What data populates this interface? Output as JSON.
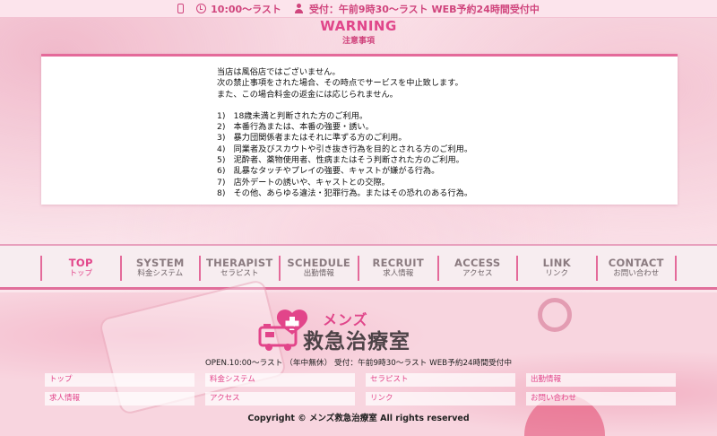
{
  "topbar": {
    "hours": "10:00〜ラスト",
    "reception": "受付：午前9時30〜ラスト WEB予約24時間受付中"
  },
  "warning": {
    "title": "WARNING",
    "subtitle": "注意事項",
    "intro": [
      "当店は風俗店ではございません。",
      "次の禁止事項をされた場合、その時点でサービスを中止致します。",
      "また、この場合料金の返金には応じられません。"
    ],
    "rules": [
      "1)　18歳未満と判断された方のご利用。",
      "2)　本番行為または、本番の強要・誘い。",
      "3)　暴力団関係者またはそれに準ずる方のご利用。",
      "4)　同業者及びスカウトや引き抜き行為を目的とされる方のご利用。",
      "5)　泥酔者、薬物使用者、性病またはそう判断された方のご利用。",
      "6)　乱暴なタッチやプレイの強要、キャストが嫌がる行為。",
      "7)　店外デートの誘いや、キャストとの交際。",
      "8)　その他、あらゆる違法・犯罪行為。またはその恐れのある行為。"
    ]
  },
  "nav": [
    {
      "en": "TOP",
      "jp": "トップ",
      "active": true
    },
    {
      "en": "SYSTEM",
      "jp": "料金システム"
    },
    {
      "en": "THERAPIST",
      "jp": "セラピスト"
    },
    {
      "en": "SCHEDULE",
      "jp": "出勤情報"
    },
    {
      "en": "RECRUIT",
      "jp": "求人情報"
    },
    {
      "en": "ACCESS",
      "jp": "アクセス"
    },
    {
      "en": "LINK",
      "jp": "リンク"
    },
    {
      "en": "CONTACT",
      "jp": "お問い合わせ"
    }
  ],
  "footer": {
    "logo_top": "メンズ",
    "logo_main": "救急治療室",
    "hours": "OPEN.10:00〜ラスト （年中無休） 受付：午前9時30〜ラスト WEB予約24時間受付中",
    "links": [
      "トップ",
      "料金システム",
      "セラピスト",
      "出勤情報",
      "求人情報",
      "アクセス",
      "リンク",
      "お問い合わせ"
    ],
    "copyright": "Copyright © メンズ救急治療室 All rights reserved"
  },
  "colors": {
    "accent": "#e2458a",
    "nav_border": "#e46a9a",
    "background": "#fbe6ec"
  },
  "icons": [
    "phone-icon",
    "clock-icon",
    "user-icon"
  ]
}
